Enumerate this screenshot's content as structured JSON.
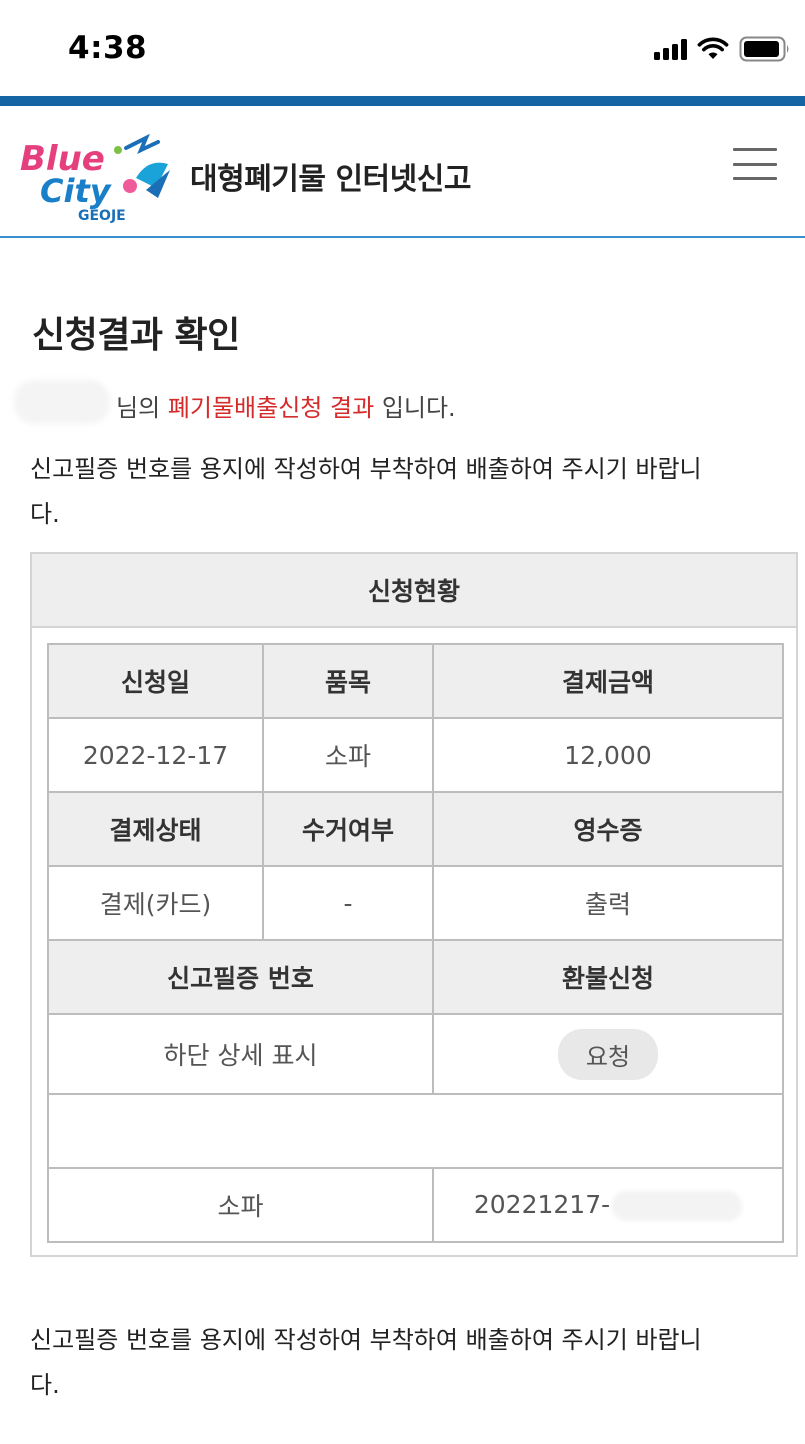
{
  "status_bar": {
    "time": "4:38"
  },
  "header": {
    "logo_line1": "Blue",
    "logo_line2": "City",
    "logo_line3": "GEOJE",
    "title": "대형폐기물 인터넷신고"
  },
  "page": {
    "title": "신청결과 확인",
    "intro_prefix": "님의",
    "intro_highlight": "폐기물배출신청 결과",
    "intro_suffix": "입니다.",
    "notice_line1": "신고필증 번호를 용지에 작성하여 부착하여 배출하여 주시기 바랍니",
    "notice_line2": "다."
  },
  "result_table": {
    "heading": "신청현황",
    "row1_headers": [
      "신청일",
      "품목",
      "결제금액"
    ],
    "row1_values": [
      "2022-12-17",
      "소파",
      "12,000"
    ],
    "row2_headers": [
      "결제상태",
      "수거여부",
      "영수증"
    ],
    "row2_values": [
      "결제(카드)",
      "-",
      "출력"
    ],
    "row3_headers": [
      "신고필증 번호",
      "환불신청"
    ],
    "detail_text": "하단 상세 표시",
    "refund_button": "요청",
    "item_name": "소파",
    "certificate_prefix": "20221217-"
  },
  "colors": {
    "brand_blue": "#1565a5",
    "highlight_red": "#d62b2b",
    "header_gray": "#eeeeee"
  }
}
